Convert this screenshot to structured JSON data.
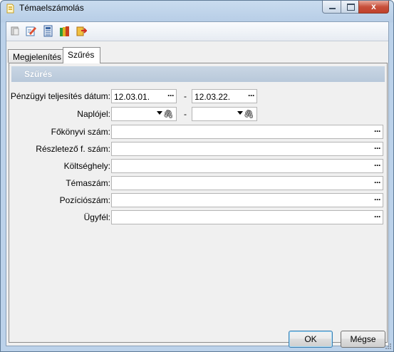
{
  "window": {
    "title": "Témaelszámolás",
    "close_glyph": "x"
  },
  "toolbar": {
    "buttons": [
      "clear-icon",
      "edit-icon",
      "calculator-icon",
      "books-icon",
      "export-icon"
    ]
  },
  "tabs": [
    {
      "label": "Megjelenítés",
      "active": false
    },
    {
      "label": "Szűrés",
      "active": true
    }
  ],
  "section": {
    "title": "Szűrés"
  },
  "filters": {
    "date": {
      "label": "Pénzügyi teljesítés dátum:",
      "from": "12.03.01.",
      "to": "12.03.22."
    },
    "journal": {
      "label": "Naplójel:",
      "from": "",
      "to": ""
    },
    "range_separator": "-",
    "fields": [
      {
        "label": "Főkönyvi szám:",
        "value": ""
      },
      {
        "label": "Részletező f. szám:",
        "value": ""
      },
      {
        "label": "Költséghely:",
        "value": ""
      },
      {
        "label": "Témaszám:",
        "value": ""
      },
      {
        "label": "Pozíciószám:",
        "value": ""
      },
      {
        "label": "Ügyfél:",
        "value": ""
      }
    ],
    "lookup_glyph": "···",
    "attach_glyph": "🖇"
  },
  "buttons": {
    "ok": "OK",
    "cancel": "Mégse"
  },
  "colors": {
    "section_header": "#bccbdc",
    "default_button_border": "#3c7fb1",
    "close_button": "#c7503b"
  }
}
